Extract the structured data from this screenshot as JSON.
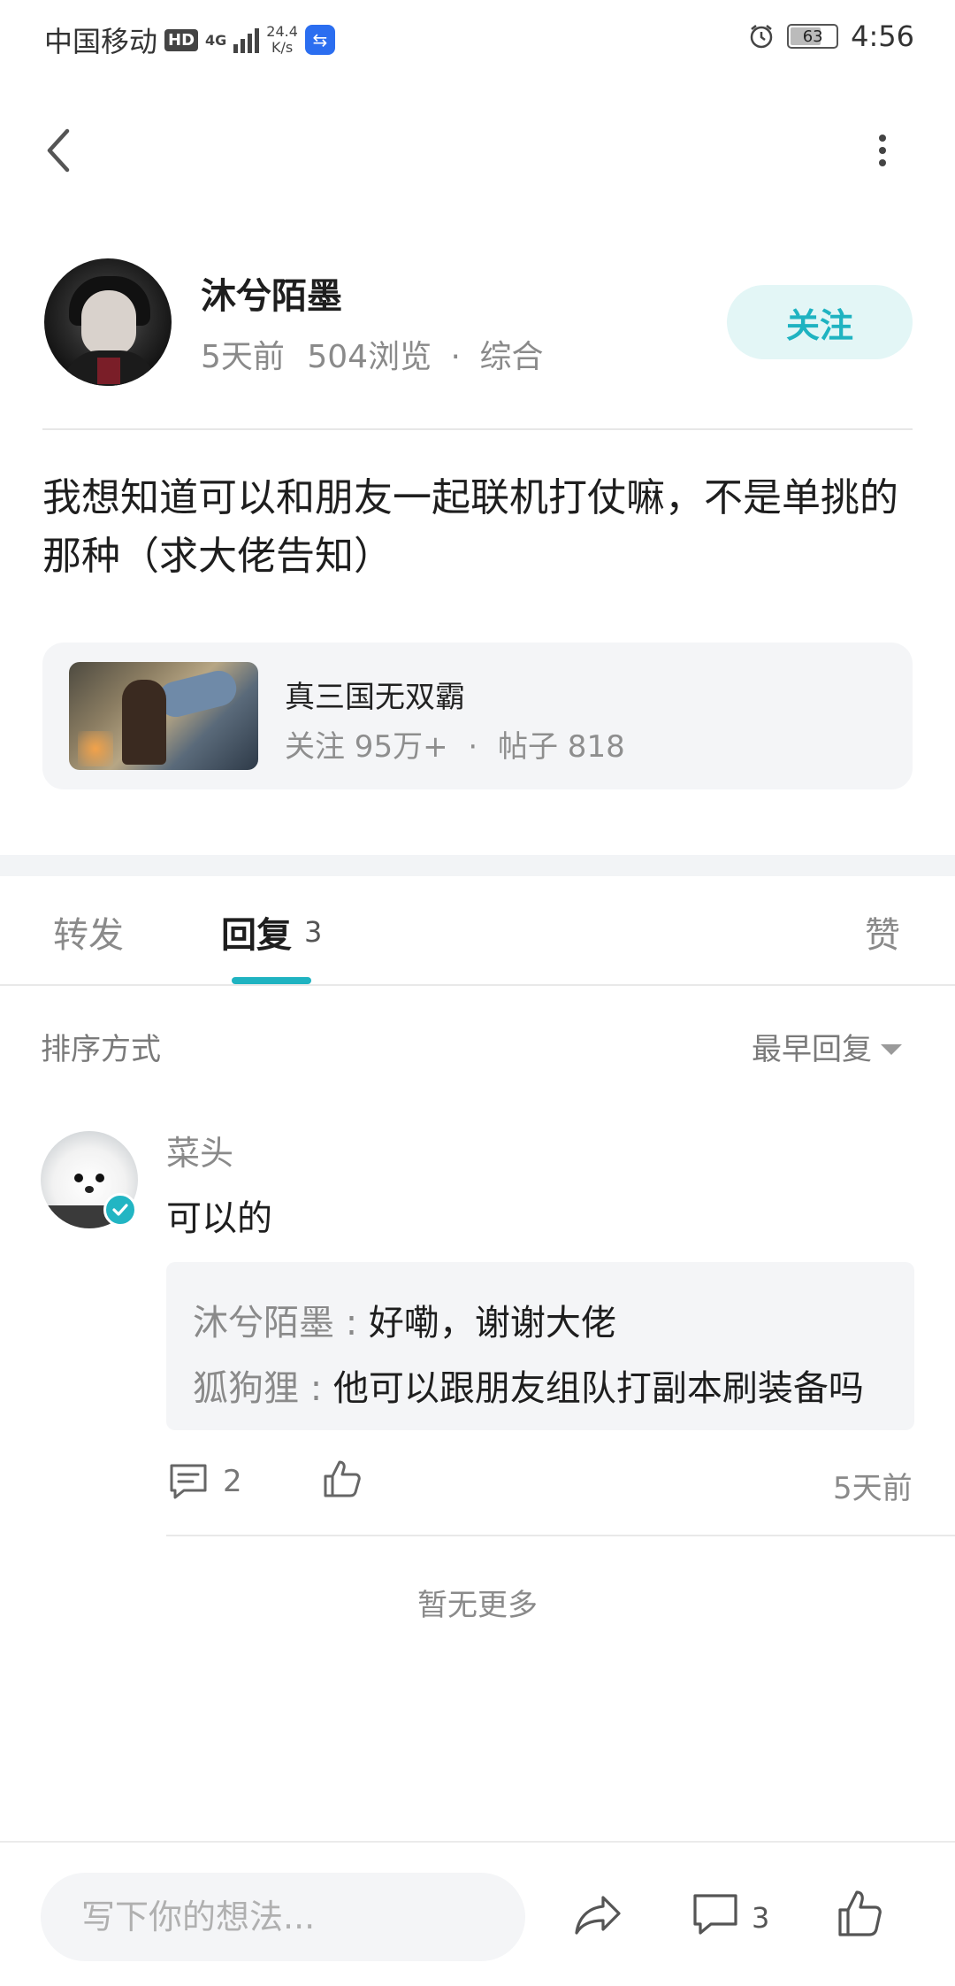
{
  "status_bar": {
    "carrier": "中国移动",
    "hd": "HD",
    "network_gen": "4G",
    "speed_value": "24.4",
    "speed_unit": "K/s",
    "battery": "63",
    "time": "4:56"
  },
  "post": {
    "author": "沐兮陌墨",
    "time_ago": "5天前",
    "views": "504浏览",
    "category": "综合",
    "follow_label": "关注",
    "body": "我想知道可以和朋友一起联机打仗嘛，不是单挑的那种（求大佬告知）"
  },
  "forum": {
    "name": "真三国无双霸",
    "followers": "关注 95万+",
    "posts": "帖子 818"
  },
  "tabs": {
    "repost": "转发",
    "reply": "回复",
    "reply_count": "3",
    "like": "赞"
  },
  "sort": {
    "label": "排序方式",
    "value": "最早回复"
  },
  "comments": [
    {
      "name": "菜头",
      "text": "可以的",
      "replies": [
        {
          "who": "沐兮陌墨",
          "sep": " : ",
          "text": "好嘞，谢谢大佬"
        },
        {
          "who": "狐狗狸",
          "sep": " : ",
          "text": "他可以跟朋友组队打副本刷装备吗"
        }
      ],
      "comment_count": "2",
      "time": "5天前"
    }
  ],
  "no_more": "暂无更多",
  "bottom_bar": {
    "input_placeholder": "写下你的想法...",
    "comment_count": "3"
  },
  "colors": {
    "accent": "#1fb3c1",
    "follow_bg": "#e3f6f6",
    "card_bg": "#f4f5f7"
  },
  "icons": [
    "back-icon",
    "more-vertical-icon",
    "verified-icon",
    "comment-icon",
    "thumb-up-icon",
    "share-icon",
    "dropdown-caret-icon"
  ]
}
